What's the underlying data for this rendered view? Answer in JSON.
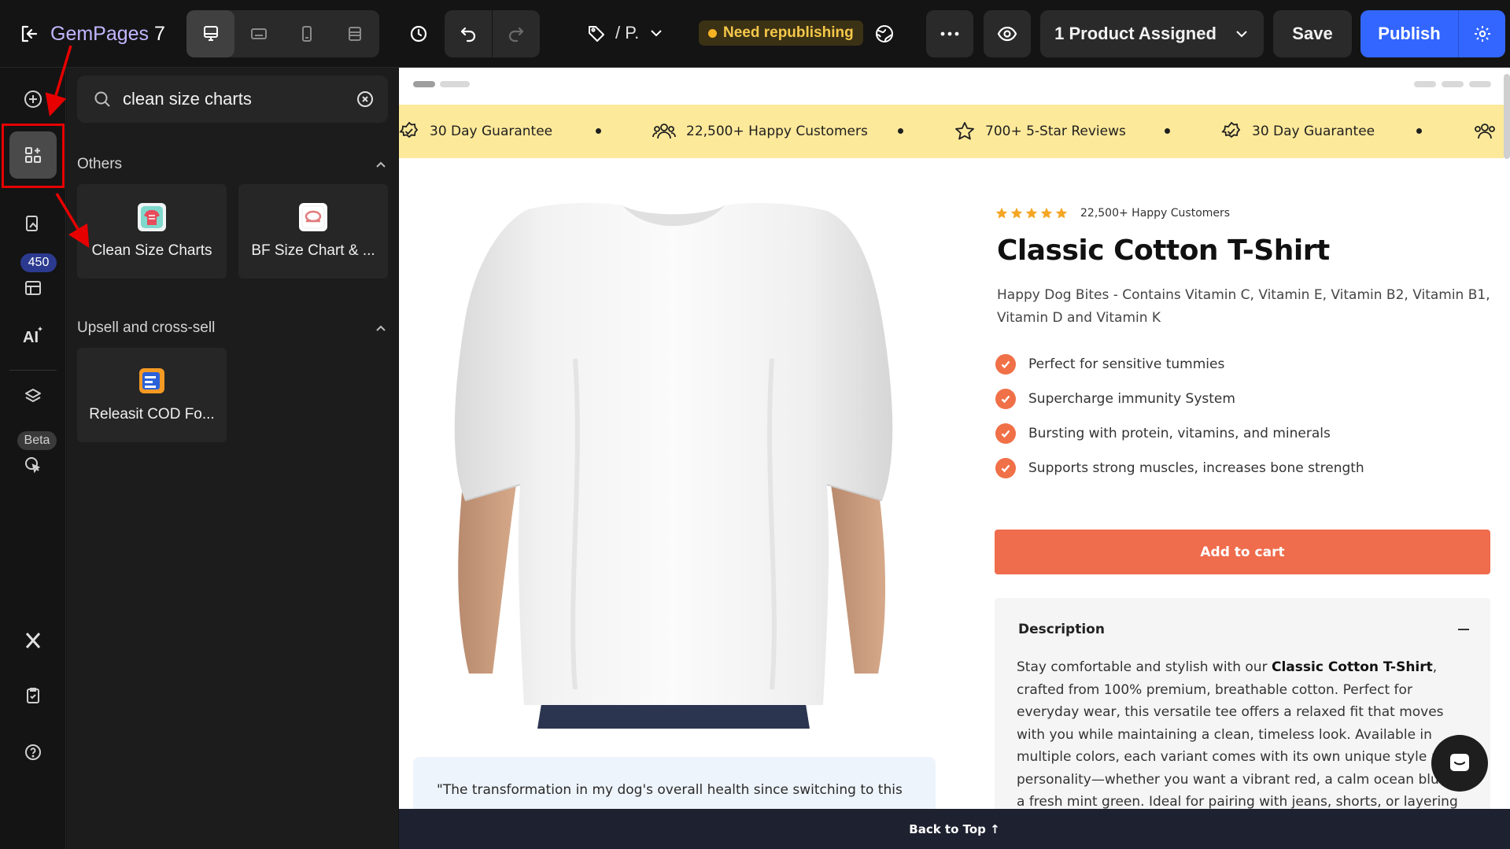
{
  "app": {
    "name": "GemPages",
    "version": "7",
    "brand_color": "#3366ff",
    "annotation_color": "#e60000"
  },
  "toolbar": {
    "devices": [
      "desktop-icon",
      "tablet-landscape-icon",
      "mobile-icon",
      "fullscreen-icon"
    ],
    "page_label": "/ P.",
    "status_badge": "Need republishing",
    "assigned_label": "1 Product Assigned",
    "save_label": "Save",
    "publish_label": "Publish"
  },
  "rail": {
    "count_badge": "450",
    "beta_badge": "Beta"
  },
  "panel": {
    "search": {
      "value": "clean size charts",
      "placeholder": "Search"
    },
    "sections": [
      {
        "title": "Others",
        "items": [
          {
            "label": "Clean Size Charts"
          },
          {
            "label": "BF Size Chart & ..."
          }
        ]
      },
      {
        "title": "Upsell and cross-sell",
        "items": [
          {
            "label": "Releasit COD Fo..."
          }
        ]
      }
    ]
  },
  "canvas": {
    "announcements": [
      "30 Day Guarantee",
      "22,500+ Happy Customers",
      "700+ 5-Star Reviews",
      "30 Day Guarantee"
    ],
    "product": {
      "rating_text": "22,500+ Happy Customers",
      "title": "Classic Cotton T-Shirt",
      "subtitle": "Happy Dog Bites - Contains Vitamin C, Vitamin E, Vitamin B2, Vitamin B1, Vitamin D and Vitamin K",
      "bullets": [
        "Perfect for sensitive tummies",
        "Supercharge immunity System",
        "Bursting with protein, vitamins, and minerals",
        "Supports strong muscles, increases bone strength"
      ],
      "add_to_cart": "Add to cart",
      "description_title": "Description",
      "description_prefix": "Stay comfortable and stylish with our ",
      "description_bold": "Classic Cotton T-Shirt",
      "description_rest": ", crafted from 100% premium, breathable cotton. Perfect for everyday wear, this versatile tee offers a relaxed fit that moves with you while maintaining a clean, timeless look. Available in multiple colors, each variant comes with its own unique style and personality—whether you want a vibrant red, a calm ocean blue, or a fresh mint green. Ideal for pairing with jeans, shorts, or layering under jackets,",
      "accent_color": "#ef6c4c",
      "star_color": "#f5a623"
    },
    "testimonial": "\"The transformation in my dog's overall health since switching to this",
    "announcement_bg": "#fde99a",
    "back_to_top": "Back to Top ↑"
  }
}
